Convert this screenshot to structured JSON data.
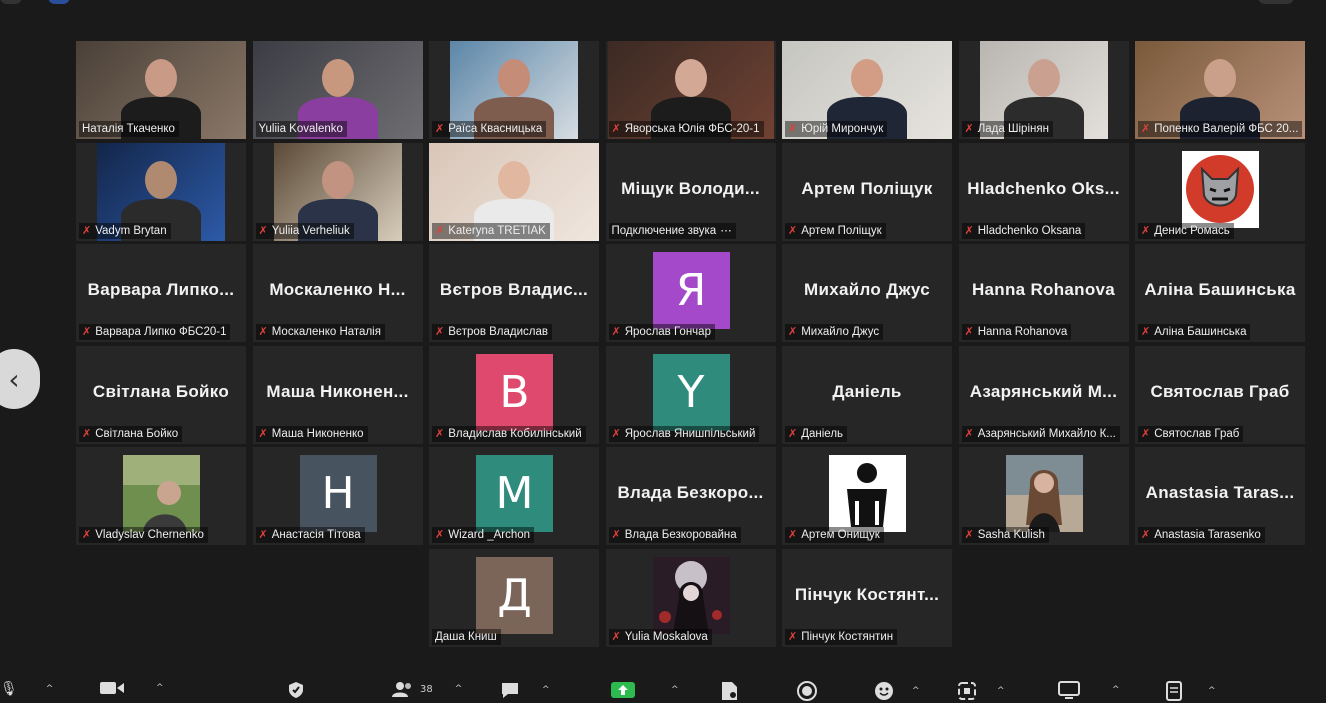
{
  "meeting": {
    "participant_count": "38",
    "tiles": [
      {
        "label": "Наталія Ткаченко",
        "kind": "video",
        "muted": false,
        "active": true
      },
      {
        "label": "Yuliia Kovalenko",
        "kind": "video",
        "muted": false
      },
      {
        "label": "Раїса Квасницька",
        "kind": "video",
        "muted": true
      },
      {
        "label": "Яворська Юлія ФБС-20-1",
        "kind": "video",
        "muted": true
      },
      {
        "label": "Юрій Мирончук",
        "kind": "video",
        "muted": true
      },
      {
        "label": "Лада Шірінян",
        "kind": "video",
        "muted": true
      },
      {
        "label": "Попенко Валерій ФБС 20...",
        "kind": "video",
        "muted": true
      },
      {
        "label": "Vadym Brytan",
        "kind": "video",
        "muted": true
      },
      {
        "label": "Yuliia Verheliuk",
        "kind": "video",
        "muted": true
      },
      {
        "label": "Kateryna TRETIAK",
        "kind": "video",
        "muted": true
      },
      {
        "label": "Подключение звука",
        "kind": "name",
        "display": "Міщук Володи...",
        "muted": false,
        "suffix": "⋯"
      },
      {
        "label": "Артем Поліщук",
        "kind": "name",
        "display": "Артем Поліщук",
        "muted": true
      },
      {
        "label": "Hladchenko Oksana",
        "kind": "name",
        "display": "Hladchenko Oks...",
        "muted": true
      },
      {
        "label": "Денис Ромась",
        "kind": "image",
        "image": "mask-icon",
        "muted": true
      },
      {
        "label": "Варвара Липко ФБС20-1",
        "kind": "name",
        "display": "Варвара Липко...",
        "muted": true
      },
      {
        "label": "Москаленко Наталія",
        "kind": "name",
        "display": "Москаленко Н...",
        "muted": true
      },
      {
        "label": "Вєтров Владислав",
        "kind": "name",
        "display": "Вєтров Владис...",
        "muted": true
      },
      {
        "label": "Ярослав Гончар",
        "kind": "avatar",
        "letter": "Я",
        "color": "#a349c9",
        "muted": true
      },
      {
        "label": "Михайло Джус",
        "kind": "name",
        "display": "Михайло Джус",
        "muted": true
      },
      {
        "label": "Hanna Rohanova",
        "kind": "name",
        "display": "Hanna Rohanova",
        "muted": true
      },
      {
        "label": "Аліна Башинська",
        "kind": "name",
        "display": "Аліна Башинська",
        "muted": true
      },
      {
        "label": "Світлана Бойко",
        "kind": "name",
        "display": "Світлана Бойко",
        "muted": true
      },
      {
        "label": "Маша Никоненко",
        "kind": "name",
        "display": "Маша Никонен...",
        "muted": true
      },
      {
        "label": "Владислав Кобилінський",
        "kind": "avatar",
        "letter": "B",
        "color": "#e0496e",
        "muted": true
      },
      {
        "label": "Ярослав Янишпільський",
        "kind": "avatar",
        "letter": "Y",
        "color": "#2f8c7d",
        "muted": true
      },
      {
        "label": "Даніель",
        "kind": "name",
        "display": "Даніель",
        "muted": true
      },
      {
        "label": "Азарянський Михайло К...",
        "kind": "name",
        "display": "Азарянський М...",
        "muted": true
      },
      {
        "label": "Святослав Граб",
        "kind": "name",
        "display": "Святослав Граб",
        "muted": true
      },
      {
        "label": "Vladyslav Chernenko",
        "kind": "image",
        "image": "selfie-photo",
        "muted": true
      },
      {
        "label": "Анастасія Тітова",
        "kind": "avatar",
        "letter": "H",
        "color": "#47535e",
        "muted": true
      },
      {
        "label": "Wizard _Archon",
        "kind": "avatar",
        "letter": "M",
        "color": "#2f8c7d",
        "muted": true
      },
      {
        "label": "Влада Безкоровайна",
        "kind": "name",
        "display": "Влада Безкоро...",
        "muted": true
      },
      {
        "label": "Артем Онищук",
        "kind": "image",
        "image": "silhouette-logo",
        "muted": true
      },
      {
        "label": "Sasha Kulish",
        "kind": "image",
        "image": "portrait-photo",
        "muted": true
      },
      {
        "label": "Anastasia Tarasenko",
        "kind": "name",
        "display": "Anastasia Taras...",
        "muted": true
      },
      {
        "label": "Даша Книш",
        "kind": "avatar",
        "letter": "Д",
        "color": "#7a6558",
        "muted": false
      },
      {
        "label": "Yulia Moskalova",
        "kind": "image",
        "image": "anime-art",
        "muted": true
      },
      {
        "label": "Пінчук Костянтин",
        "kind": "name",
        "display": "Пінчук Костянт...",
        "muted": true
      }
    ]
  },
  "toolbar": {
    "items": [
      "mic-icon",
      "video-icon",
      "security-icon",
      "participants-icon",
      "chat-icon",
      "share-screen-icon",
      "record-icon",
      "reactions-icon",
      "apps-icon",
      "whiteboard-icon",
      "notes-icon"
    ]
  },
  "colors": {
    "active_border": "#c4e24a",
    "mute": "#e0413b",
    "tile_bg": "#262626",
    "share": "#2dbb4f"
  }
}
